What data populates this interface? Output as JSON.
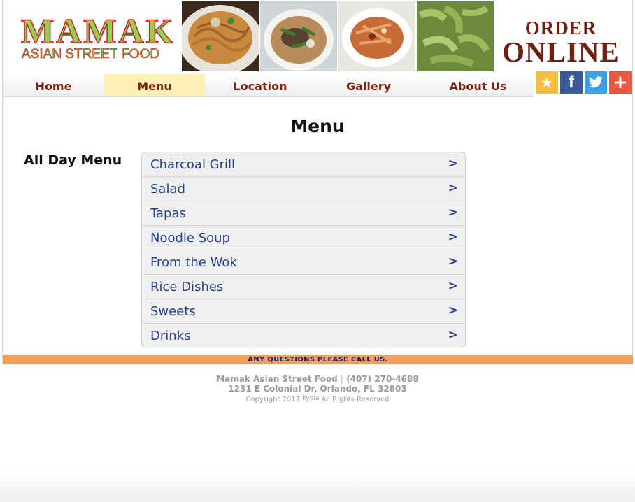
{
  "header": {
    "logo_line1": "MAMAK",
    "logo_line2": "ASIAN STREET FOOD",
    "order_line1": "ORDER",
    "order_line2": "ONLINE"
  },
  "nav": {
    "items": [
      {
        "label": "Home"
      },
      {
        "label": "Menu",
        "active": true
      },
      {
        "label": "Location"
      },
      {
        "label": "Gallery"
      },
      {
        "label": "About Us"
      }
    ]
  },
  "social": [
    {
      "icon": "star-icon",
      "glyph": "★",
      "color": "#f3bd41"
    },
    {
      "icon": "facebook-icon",
      "glyph": "f",
      "color": "#3b5b98"
    },
    {
      "icon": "twitter-icon",
      "glyph": "🐦",
      "color": "#3aa1e4"
    },
    {
      "icon": "plus-icon",
      "glyph": "+",
      "color": "#e9583e"
    }
  ],
  "main": {
    "title": "Menu",
    "section_label": "All Day Menu",
    "menu_items": [
      {
        "label": "Charcoal Grill",
        "chevron": ">"
      },
      {
        "label": "Salad",
        "chevron": ">"
      },
      {
        "label": "Tapas",
        "chevron": ">"
      },
      {
        "label": "Noodle Soup",
        "chevron": ">"
      },
      {
        "label": "From the Wok",
        "chevron": ">"
      },
      {
        "label": "Rice Dishes",
        "chevron": ">"
      },
      {
        "label": "Sweets",
        "chevron": ">"
      },
      {
        "label": "Drinks",
        "chevron": ">"
      }
    ]
  },
  "footer": {
    "call_text": "ANY QUESTIONS PLEASE CALL US.",
    "business": "Mamak Asian Street Food",
    "separator": "|",
    "phone": "(407) 270-4688",
    "address": "1231 E Colonial Dr, Orlando, FL 32803",
    "copyright_pre": "Copyright 2017",
    "copyright_brand": "Kydia",
    "copyright_post": "All Rights Reserved"
  },
  "colors": {
    "accent_orange": "#f09e5b",
    "nav_text": "#7a2312",
    "active_tab": "#fbf1b4",
    "menu_link": "#24408a"
  }
}
